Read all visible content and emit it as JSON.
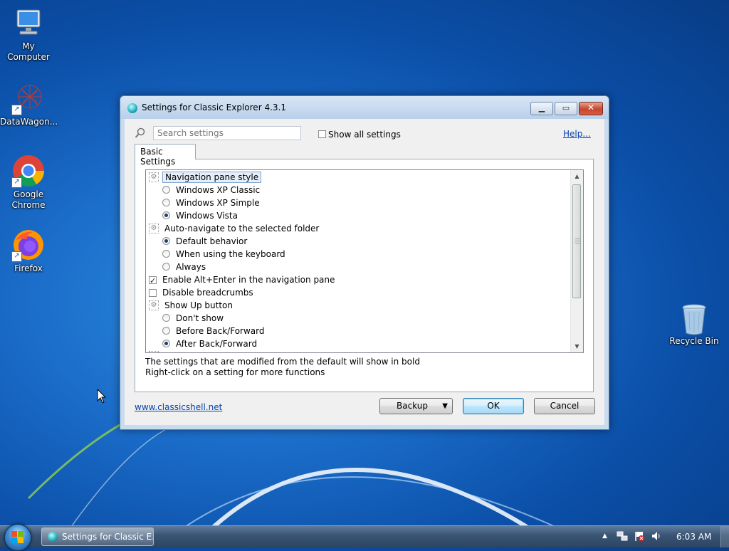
{
  "desktop": {
    "icons": [
      {
        "label": "My Computer"
      },
      {
        "label": "DataWagon..."
      },
      {
        "label": "Google Chrome"
      },
      {
        "label": "Firefox"
      },
      {
        "label": "Recycle Bin"
      }
    ]
  },
  "dialog": {
    "title": "Settings for Classic Explorer 4.3.1",
    "search": {
      "placeholder": "Search settings",
      "value": ""
    },
    "show_all_settings": {
      "label": "Show all settings",
      "checked": false
    },
    "help_link": "Help...",
    "tab": "Basic Settings",
    "settings": [
      {
        "kind": "group",
        "label": "Navigation pane style",
        "selected": true
      },
      {
        "kind": "radio",
        "label": "Windows XP Classic",
        "checked": false
      },
      {
        "kind": "radio",
        "label": "Windows XP Simple",
        "checked": false
      },
      {
        "kind": "radio",
        "label": "Windows Vista",
        "checked": true
      },
      {
        "kind": "group",
        "label": "Auto-navigate to the selected folder"
      },
      {
        "kind": "radio",
        "label": "Default behavior",
        "checked": true
      },
      {
        "kind": "radio",
        "label": "When using the keyboard",
        "checked": false
      },
      {
        "kind": "radio",
        "label": "Always",
        "checked": false
      },
      {
        "kind": "checkbox",
        "label": "Enable Alt+Enter in the navigation pane",
        "checked": true
      },
      {
        "kind": "checkbox",
        "label": "Disable breadcrumbs",
        "checked": false
      },
      {
        "kind": "group",
        "label": "Show Up button"
      },
      {
        "kind": "radio",
        "label": "Don't show",
        "checked": false
      },
      {
        "kind": "radio",
        "label": "Before Back/Forward",
        "checked": false
      },
      {
        "kind": "radio",
        "label": "After Back/Forward",
        "checked": true
      }
    ],
    "info_line1": "The settings that are modified from the default will show in bold",
    "info_line2": "Right-click on a setting for more functions",
    "footer_link": "www.classicshell.net",
    "buttons": {
      "backup": "Backup",
      "ok": "OK",
      "cancel": "Cancel"
    }
  },
  "taskbar": {
    "task_label": "Settings for Classic E...",
    "clock": "6:03 AM"
  }
}
